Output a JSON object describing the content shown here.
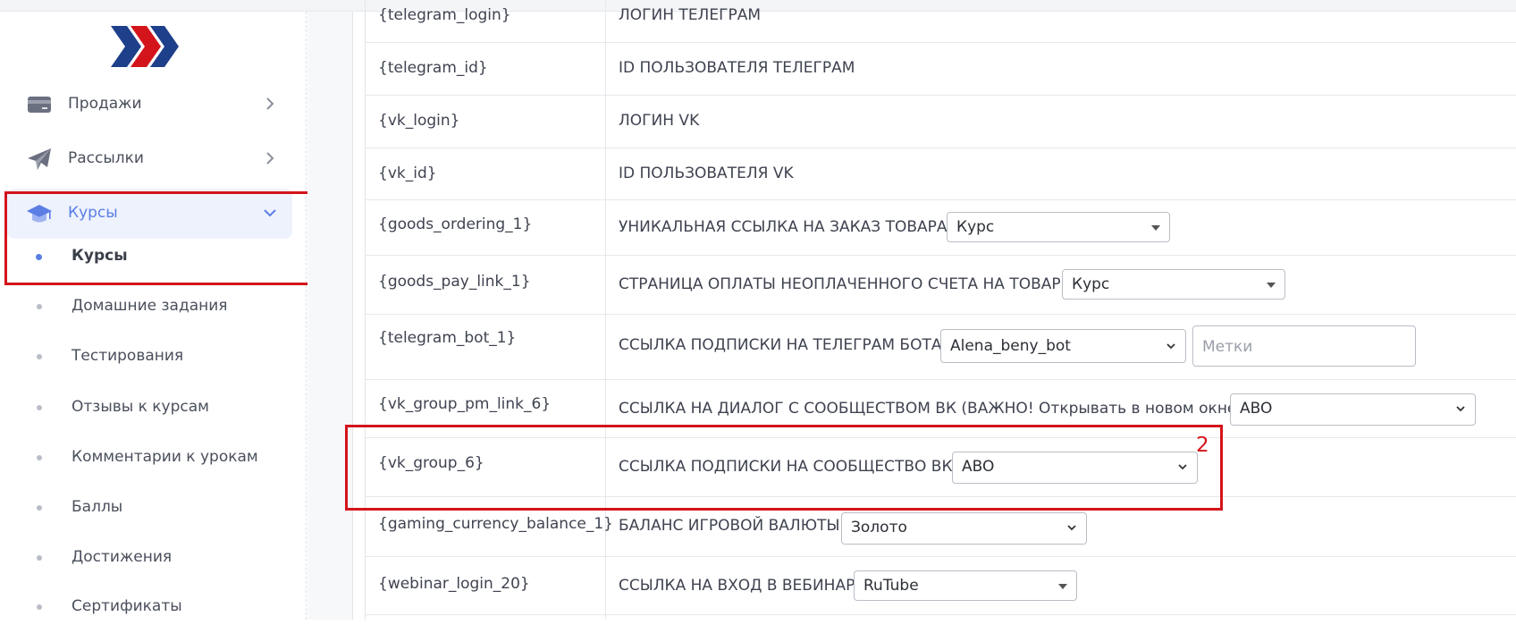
{
  "sidebar": {
    "logo": "logo",
    "items": [
      {
        "label": "Продажи",
        "icon": "card-icon"
      },
      {
        "label": "Рассылки",
        "icon": "paper-plane-icon"
      },
      {
        "label": "Курсы",
        "icon": "graduation-cap-icon"
      }
    ],
    "sub_items": [
      {
        "label": "Курсы"
      },
      {
        "label": "Домашние задания"
      },
      {
        "label": "Тестирования"
      },
      {
        "label": "Отзывы к курсам"
      },
      {
        "label": "Комментарии к урокам"
      },
      {
        "label": "Баллы"
      },
      {
        "label": "Достижения"
      },
      {
        "label": "Сертификаты"
      }
    ]
  },
  "annotation": {
    "number": "2"
  },
  "rows": [
    {
      "var": "{telegram_login}",
      "desc": "ЛОГИН ТЕЛЕГРАМ"
    },
    {
      "var": "{telegram_id}",
      "desc": "ID ПОЛЬЗОВАТЕЛЯ ТЕЛЕГРАМ"
    },
    {
      "var": "{vk_login}",
      "desc": "ЛОГИН VK"
    },
    {
      "var": "{vk_id}",
      "desc": "ID ПОЛЬЗОВАТЕЛЯ VK"
    },
    {
      "var": "{goods_ordering_1}",
      "desc": "УНИКАЛЬНАЯ ССЫЛКА НА ЗАКАЗ ТОВАРА",
      "select": "Курс"
    },
    {
      "var": "{goods_pay_link_1}",
      "desc": "СТРАНИЦА ОПЛАТЫ НЕОПЛАЧЕННОГО СЧЕТА НА ТОВАР",
      "select": "Курс"
    },
    {
      "var": "{telegram_bot_1}",
      "desc": "ССЫЛКА ПОДПИСКИ НА ТЕЛЕГРАМ БОТА",
      "select": "Alena_beny_bot",
      "input_placeholder": "Метки"
    },
    {
      "var": "{vk_group_pm_link_6}",
      "desc": "ССЫЛКА НА ДИАЛОГ С СООБЩЕСТВОМ ВК (ВАЖНО! Открывать в новом окне)",
      "select": "ABO"
    },
    {
      "var": "{vk_group_6}",
      "desc": "ССЫЛКА ПОДПИСКИ НА СООБЩЕСТВО ВК",
      "select": "ABO"
    },
    {
      "var": "{gaming_currency_balance_1}",
      "desc": "БАЛАНС ИГРОВОЙ ВАЛЮТЫ",
      "select": "Золото"
    },
    {
      "var": "{webinar_login_20}",
      "desc": "ССЫЛКА НА ВХОД В ВЕБИНАР",
      "select": "RuTube"
    }
  ]
}
